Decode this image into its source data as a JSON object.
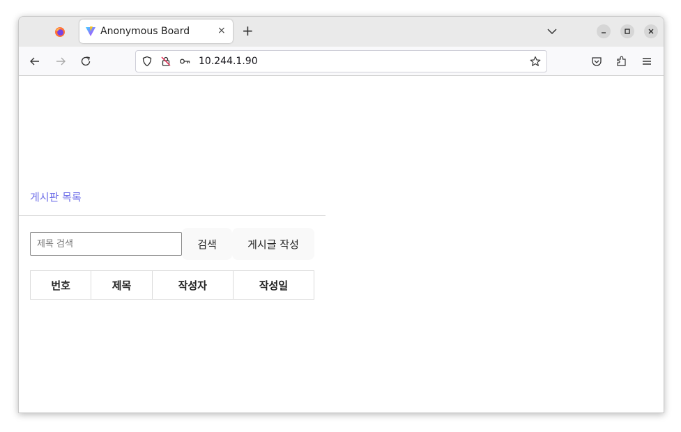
{
  "browser": {
    "tab": {
      "title": "Anonymous Board",
      "close_glyph": "×"
    },
    "new_tab_glyph": "+",
    "url": "10.244.1.90",
    "icons": {
      "firefox": "firefox-logo-icon",
      "favicon": "vite-favicon-icon",
      "back": "back-arrow-icon",
      "forward": "forward-arrow-icon",
      "reload": "reload-icon",
      "shield": "tracking-shield-icon",
      "insecure": "insecure-lock-icon",
      "key": "key-icon",
      "star": "bookmark-star-icon",
      "pocket": "pocket-icon",
      "extensions": "extensions-icon",
      "menu": "hamburger-menu-icon"
    },
    "colors": {
      "tabstrip": "#eaeaea",
      "navbar": "#f9f9fb"
    }
  },
  "page": {
    "board_title": "게시판 목록",
    "search": {
      "placeholder": "제목 검색",
      "value": ""
    },
    "search_button": "검색",
    "write_button": "게시글 작성",
    "table": {
      "headers": [
        "번호",
        "제목",
        "작성자",
        "작성일"
      ],
      "rows": []
    },
    "colors": {
      "title": "#6f6fe8"
    }
  }
}
